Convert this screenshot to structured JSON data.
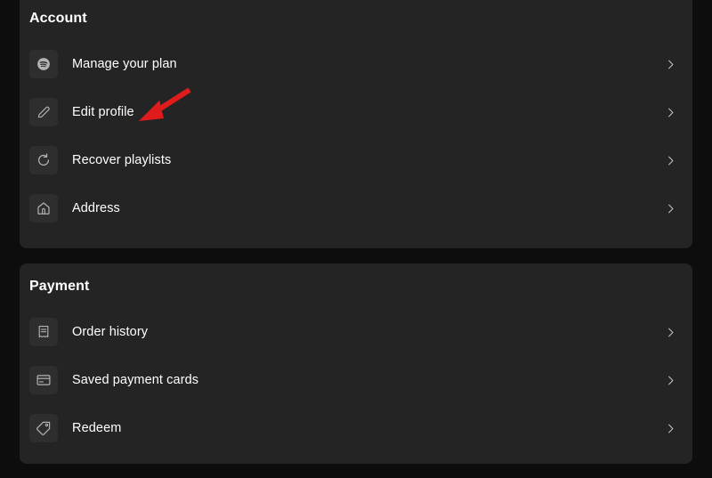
{
  "theme": {
    "page_background": "#0d0d0d",
    "panel_background": "#242424",
    "icon_tile_background": "#2e2e2e",
    "text_color": "#ffffff",
    "icon_color": "#b3b3b3",
    "chevron_color": "#b3b3b3",
    "annotation_color": "#e01b1b"
  },
  "sections": [
    {
      "title": "Account",
      "items": [
        {
          "label": "Manage your plan",
          "icon": "spotify-icon",
          "chevron": "chevron-right-icon"
        },
        {
          "label": "Edit profile",
          "icon": "pencil-icon",
          "chevron": "chevron-right-icon"
        },
        {
          "label": "Recover playlists",
          "icon": "restore-circular-arrow-icon",
          "chevron": "chevron-right-icon"
        },
        {
          "label": "Address",
          "icon": "home-icon",
          "chevron": "chevron-right-icon"
        }
      ]
    },
    {
      "title": "Payment",
      "items": [
        {
          "label": "Order history",
          "icon": "receipt-icon",
          "chevron": "chevron-right-icon"
        },
        {
          "label": "Saved payment cards",
          "icon": "credit-card-icon",
          "chevron": "chevron-right-icon"
        },
        {
          "label": "Redeem",
          "icon": "tag-icon",
          "chevron": "chevron-right-icon"
        }
      ]
    }
  ],
  "annotation": {
    "type": "red-arrow",
    "points_to": "Edit profile",
    "color": "#e01b1b"
  }
}
